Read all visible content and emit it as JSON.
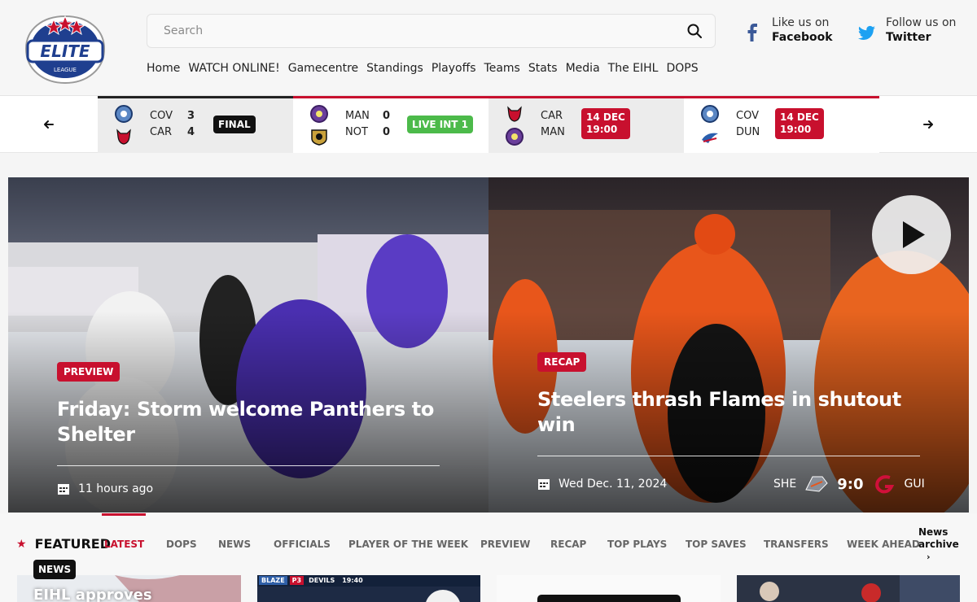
{
  "header": {
    "logo_text": "ELITE",
    "logo_sub": "LEAGUE",
    "search_placeholder": "Search",
    "nav": [
      "Home",
      "WATCH ONLINE!",
      "Gamecentre",
      "Standings",
      "Playoffs",
      "Teams",
      "Stats",
      "Media",
      "The EIHL",
      "DOPS"
    ],
    "facebook": {
      "line1": "Like us on",
      "line2": "Facebook"
    },
    "twitter": {
      "line1": "Follow us on",
      "line2": "Twitter"
    }
  },
  "scores": [
    {
      "home": "COV",
      "away": "CAR",
      "home_score": "3",
      "away_score": "4",
      "status": "FINAL",
      "status_color": "#111111"
    },
    {
      "home": "MAN",
      "away": "NOT",
      "home_score": "0",
      "away_score": "0",
      "status": "LIVE INT 1",
      "status_color": "#4cba4a"
    },
    {
      "home": "CAR",
      "away": "MAN",
      "home_score": "",
      "away_score": "",
      "status_line1": "14 DEC",
      "status_line2": "19:00",
      "status_color": "#c8102e"
    },
    {
      "home": "COV",
      "away": "DUN",
      "home_score": "",
      "away_score": "",
      "status_line1": "14 DEC",
      "status_line2": "19:00",
      "status_color": "#c8102e"
    }
  ],
  "hero": [
    {
      "tag": "PREVIEW",
      "title": "Friday: Storm welcome Panthers to Shelter",
      "date": "11 hours ago"
    },
    {
      "tag": "RECAP",
      "title": "Steelers thrash Flames in shutout win",
      "date": "Wed Dec. 11, 2024",
      "home": "SHE",
      "score": "9:0",
      "away": "GUI"
    }
  ],
  "featured": {
    "title": "FEATURED",
    "tabs": [
      "LATEST",
      "DOPS",
      "NEWS",
      "OFFICIALS",
      "PLAYER OF THE WEEK",
      "PREVIEW",
      "RECAP",
      "TOP PLAYS",
      "TOP SAVES",
      "TRANSFERS",
      "WEEK AHEAD"
    ],
    "archive_line1": "News",
    "archive_line2": "archive",
    "first_card_badge": "NEWS",
    "first_card_title": "EIHL approves",
    "second_card_scoreboard": {
      "home": "BLAZE",
      "period": "P3",
      "away": "DEVILS",
      "clock": "19:40"
    }
  },
  "colors": {
    "accent": "#c8102e",
    "live": "#4cba4a",
    "facebook": "#3b5998",
    "twitter": "#1da1f2"
  }
}
